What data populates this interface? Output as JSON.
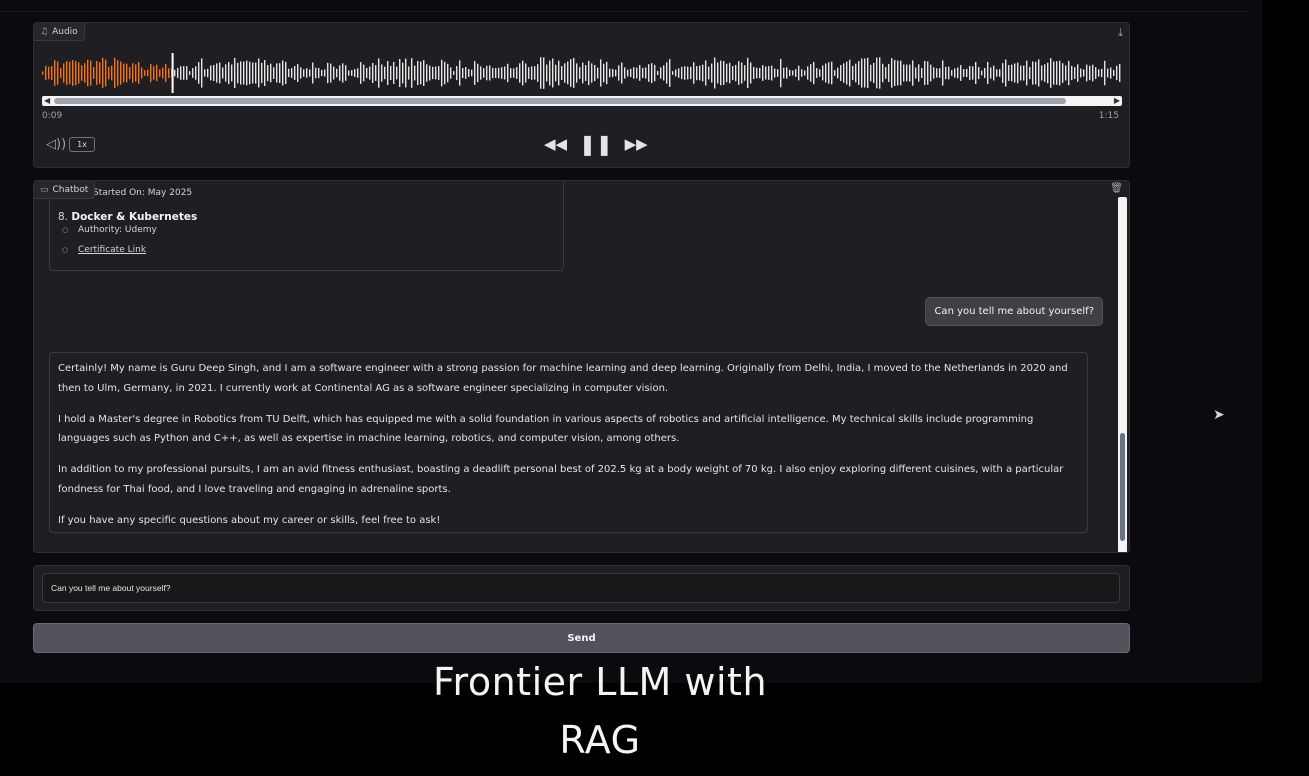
{
  "audio": {
    "label": "Audio",
    "label_icon": "music-note-icon",
    "current_time": "0:09",
    "duration": "1:15",
    "speed": "1x",
    "progress": 0.12,
    "played_color": "#f97316",
    "unplayed_color": "#e4e4e7"
  },
  "chatbot": {
    "label": "Chatbot",
    "label_icon": "chat-icon",
    "previous_message": {
      "started_on": "Started On: May 2025",
      "item_number": "8.",
      "item_title": "Docker & Kubernetes",
      "authority": "Authority: Udemy",
      "certificate_link": "Certificate Link"
    },
    "user_message": "Can you tell me about yourself?",
    "bot_message": [
      "Certainly! My name is Guru Deep Singh, and I am a software engineer with a strong passion for machine learning and deep learning. Originally from Delhi, India, I moved to the Netherlands in 2020 and then to Ulm, Germany, in 2021. I currently work at Continental AG as a software engineer specializing in computer vision.",
      "I hold a Master's degree in Robotics from TU Delft, which has equipped me with a solid foundation in various aspects of robotics and artificial intelligence. My technical skills include programming languages such as Python and C++, as well as expertise in machine learning, robotics, and computer vision, among others.",
      "In addition to my professional pursuits, I am an avid fitness enthusiast, boasting a deadlift personal best of 202.5 kg at a body weight of 70 kg. I also enjoy exploring different cuisines, with a particular fondness for Thai food, and I love traveling and engaging in adrenaline sports.",
      "If you have any specific questions about my career or skills, feel free to ask!"
    ]
  },
  "input": {
    "value": "Can you tell me about yourself?"
  },
  "send_label": "Send",
  "caption": {
    "line1": "Frontier LLM with",
    "line2": "RAG"
  }
}
